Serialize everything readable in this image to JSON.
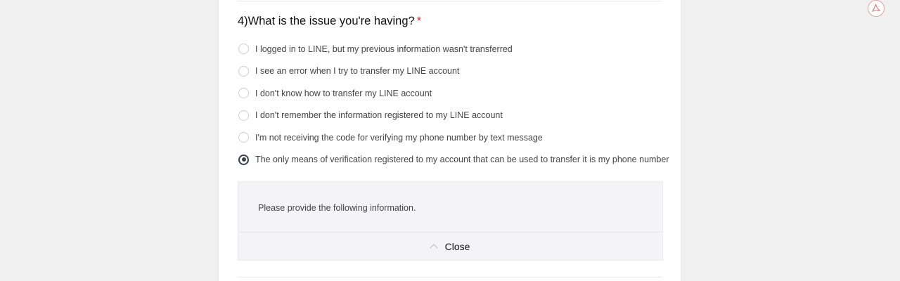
{
  "question": {
    "title": "4)What is the issue you're having?",
    "required_marker": "*",
    "options": [
      {
        "label": "I logged in to LINE, but my previous information wasn't transferred",
        "selected": false
      },
      {
        "label": "I see an error when I try to transfer my LINE account",
        "selected": false
      },
      {
        "label": "I don't know how to transfer my LINE account",
        "selected": false
      },
      {
        "label": "I don't remember the information registered to my LINE account",
        "selected": false
      },
      {
        "label": "I'm not receiving the code for verifying my phone number by text message",
        "selected": false
      },
      {
        "label": "The only means of verification registered to my account that can be used to transfer it is my phone number",
        "selected": true
      }
    ]
  },
  "info_panel": {
    "text": "Please provide the following information.",
    "close_label": "Close",
    "close_icon": "chevron-up-icon"
  },
  "floating_badge": {
    "icon": "pdf-icon"
  },
  "colors": {
    "page_background": "#f0f0f0",
    "card_background": "#ffffff",
    "required": "#e32b2b",
    "radio_selected": "#3a3f4b",
    "panel_background": "#f4f4f6"
  }
}
